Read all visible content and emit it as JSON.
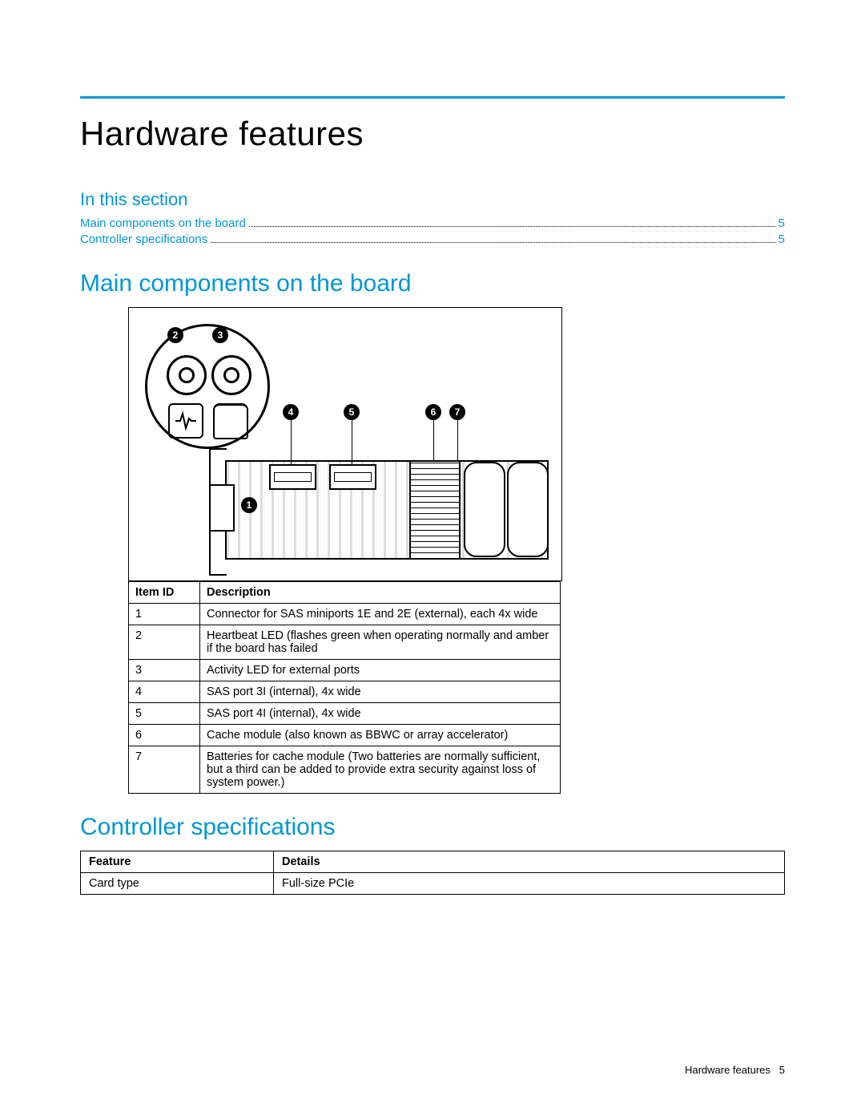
{
  "page": {
    "title": "Hardware features",
    "in_this_section": "In this section",
    "footer_label": "Hardware features",
    "footer_page": "5"
  },
  "toc": [
    {
      "label": "Main components on the board",
      "page": "5"
    },
    {
      "label": "Controller specifications",
      "page": "5"
    }
  ],
  "sections": {
    "main_components": "Main components on the board",
    "controller_specs": "Controller specifications"
  },
  "callouts": [
    "1",
    "2",
    "3",
    "4",
    "5",
    "6",
    "7"
  ],
  "components_table": {
    "headers": {
      "id": "Item ID",
      "desc": "Description"
    },
    "rows": [
      {
        "id": "1",
        "desc": "Connector for SAS miniports 1E and 2E (external), each 4x wide"
      },
      {
        "id": "2",
        "desc": "Heartbeat LED (flashes green when operating normally and amber if the board has failed"
      },
      {
        "id": "3",
        "desc": "Activity LED for external ports"
      },
      {
        "id": "4",
        "desc": "SAS port 3I (internal), 4x wide"
      },
      {
        "id": "5",
        "desc": "SAS port 4I (internal), 4x wide"
      },
      {
        "id": "6",
        "desc": "Cache module (also known as BBWC or array accelerator)"
      },
      {
        "id": "7",
        "desc": "Batteries for cache module (Two batteries are normally sufficient, but a third can be added to provide extra security against loss of system power.)"
      }
    ]
  },
  "controller_table": {
    "headers": {
      "feature": "Feature",
      "details": "Details"
    },
    "rows": [
      {
        "feature": "Card type",
        "details": "Full-size PCIe"
      }
    ]
  }
}
